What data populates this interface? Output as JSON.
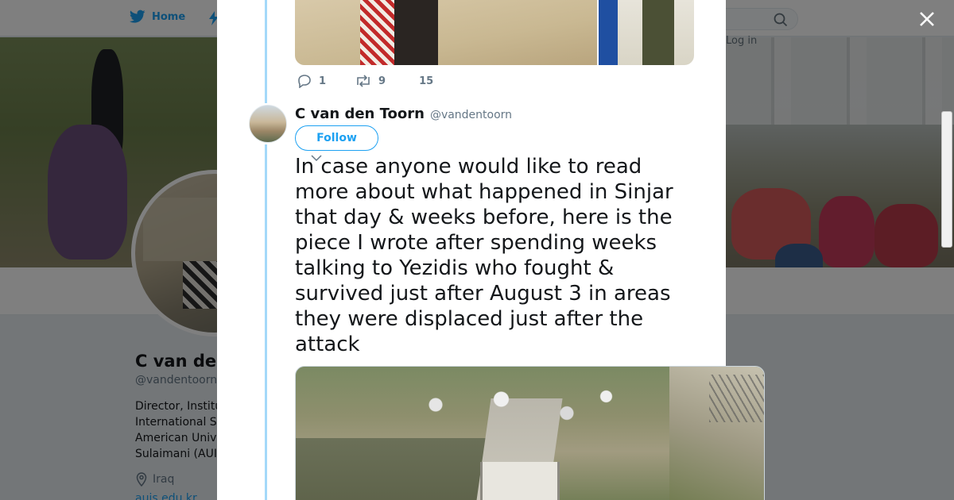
{
  "nav": {
    "home_label": "Home",
    "login_label": "Log in",
    "search_icon": "search-icon"
  },
  "profile": {
    "name": "C van den",
    "handle": "@vandentoorn",
    "bio_lines": [
      "Director, Institu",
      "International S",
      "American Univ",
      "Sulaimani (AUI"
    ],
    "location": "Iraq",
    "link": "auis.edu.kr"
  },
  "previous_tweet": {
    "replies": "1",
    "retweets": "9",
    "likes": "15"
  },
  "tweet": {
    "author_name": "C van den Toorn",
    "author_handle": "@vandentoorn",
    "follow_label": "Follow",
    "text": "In case anyone would like to read more about what happened in Sinjar that day & weeks before, here is the piece I wrote after spending weeks talking to Yezidis who fought & survived just after August 3 in areas they were displaced just after the attack"
  },
  "colors": {
    "accent": "#1da1f2",
    "thread_line": "#a4d9f9",
    "text": "#14171a",
    "muted": "#657786",
    "overlay": "rgba(0,0,0,0.5)"
  }
}
